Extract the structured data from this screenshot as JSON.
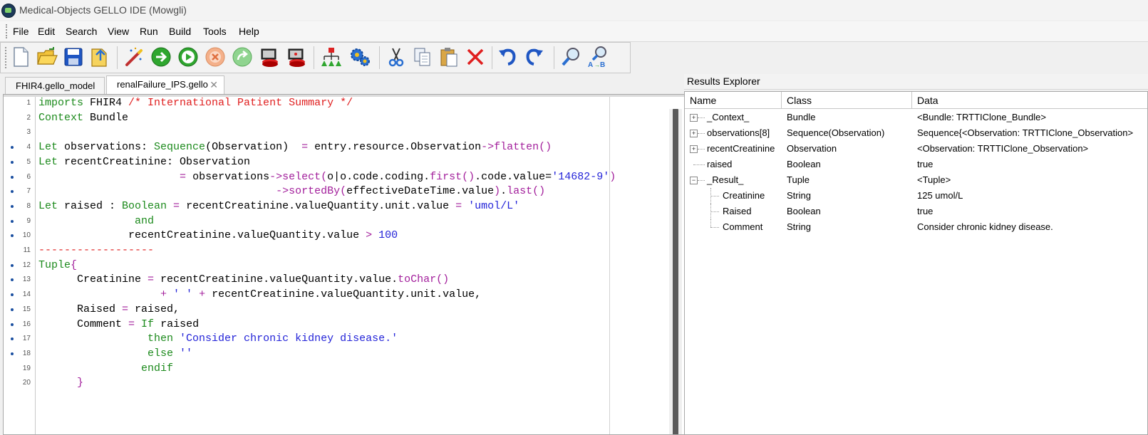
{
  "window": {
    "title": "Medical-Objects GELLO IDE (Mowgli)"
  },
  "menu": [
    "File",
    "Edit",
    "Search",
    "View",
    "Run",
    "Build",
    "Tools",
    "Help"
  ],
  "toolbar": {
    "icons": [
      "new-file-icon",
      "open-folder-icon",
      "save-icon",
      "open-recent-icon",
      "magic-wand-icon",
      "go-arrow-icon",
      "run-icon",
      "stop-icon",
      "step-icon",
      "debug-red-icon",
      "debug-red2-icon",
      "hierarchy-icon",
      "settings-gears-icon",
      "cut-icon",
      "copy-icon",
      "paste-icon",
      "delete-icon",
      "undo-icon",
      "redo-icon",
      "find-icon",
      "replace-icon"
    ]
  },
  "tabs": [
    {
      "label": "FHIR4.gello_model"
    },
    {
      "label": "renalFailure_IPS.gello",
      "close": "✕"
    }
  ],
  "editor": {
    "lines": [
      {
        "n": "1",
        "dot": false,
        "parts": [
          [
            "kw",
            "imports "
          ],
          [
            "id",
            "FHIR4 "
          ],
          [
            "cm",
            "/* International Patient Summary */"
          ]
        ]
      },
      {
        "n": "2",
        "dot": false,
        "parts": [
          [
            "kw",
            "Context "
          ],
          [
            "id",
            "Bundle"
          ]
        ]
      },
      {
        "n": "3",
        "dot": false,
        "parts": []
      },
      {
        "n": "4",
        "dot": true,
        "parts": [
          [
            "kw",
            "Let "
          ],
          [
            "id",
            "observations: "
          ],
          [
            "kw",
            "Sequence"
          ],
          [
            "id",
            "(Observation)  "
          ],
          [
            "op",
            "= "
          ],
          [
            "id",
            "entry.resource.Observation"
          ],
          [
            "op",
            "->flatten()"
          ]
        ]
      },
      {
        "n": "5",
        "dot": true,
        "parts": [
          [
            "kw",
            "Let "
          ],
          [
            "id",
            "recentCreatinine: Observation"
          ]
        ]
      },
      {
        "n": "6",
        "dot": true,
        "parts": [
          [
            "id",
            "                      "
          ],
          [
            "op",
            "= "
          ],
          [
            "id",
            "observations"
          ],
          [
            "op",
            "->select("
          ],
          [
            "id",
            "o|o.code.coding."
          ],
          [
            "op",
            "first()"
          ],
          [
            "id",
            ".code.value="
          ],
          [
            "str",
            "'14682-9'"
          ],
          [
            "op",
            ")"
          ]
        ]
      },
      {
        "n": "7",
        "dot": true,
        "parts": [
          [
            "id",
            "                                     "
          ],
          [
            "op",
            "->sortedBy("
          ],
          [
            "id",
            "effectiveDateTime.value"
          ],
          [
            "op",
            ")"
          ],
          [
            "id",
            "."
          ],
          [
            "op",
            "last()"
          ]
        ]
      },
      {
        "n": "8",
        "dot": true,
        "parts": [
          [
            "kw",
            "Let "
          ],
          [
            "id",
            "raised : "
          ],
          [
            "kw",
            "Boolean "
          ],
          [
            "op",
            "= "
          ],
          [
            "id",
            "recentCreatinine.valueQuantity.unit.value "
          ],
          [
            "op",
            "= "
          ],
          [
            "str",
            "'umol/L'"
          ]
        ]
      },
      {
        "n": "9",
        "dot": true,
        "parts": [
          [
            "id",
            "               "
          ],
          [
            "kw",
            "and"
          ]
        ]
      },
      {
        "n": "10",
        "dot": true,
        "parts": [
          [
            "id",
            "              recentCreatinine.valueQuantity.value "
          ],
          [
            "op",
            "> "
          ],
          [
            "num",
            "100"
          ]
        ]
      },
      {
        "n": "11",
        "dot": false,
        "parts": [
          [
            "dash",
            "------------------"
          ]
        ]
      },
      {
        "n": "12",
        "dot": true,
        "parts": [
          [
            "kw",
            "Tuple"
          ],
          [
            "op",
            "{"
          ]
        ]
      },
      {
        "n": "13",
        "dot": true,
        "parts": [
          [
            "id",
            "      Creatinine "
          ],
          [
            "op",
            "= "
          ],
          [
            "id",
            "recentCreatinine.valueQuantity.value."
          ],
          [
            "op",
            "toChar()"
          ]
        ]
      },
      {
        "n": "14",
        "dot": true,
        "parts": [
          [
            "id",
            "                   "
          ],
          [
            "op",
            "+ "
          ],
          [
            "str",
            "' ' "
          ],
          [
            "op",
            "+ "
          ],
          [
            "id",
            "recentCreatinine.valueQuantity.unit.value,"
          ]
        ]
      },
      {
        "n": "15",
        "dot": true,
        "parts": [
          [
            "id",
            "      Raised "
          ],
          [
            "op",
            "= "
          ],
          [
            "id",
            "raised,"
          ]
        ]
      },
      {
        "n": "16",
        "dot": true,
        "parts": [
          [
            "id",
            "      Comment "
          ],
          [
            "op",
            "= "
          ],
          [
            "kw",
            "If "
          ],
          [
            "id",
            "raised"
          ]
        ]
      },
      {
        "n": "17",
        "dot": true,
        "parts": [
          [
            "id",
            "                 "
          ],
          [
            "kw",
            "then "
          ],
          [
            "str",
            "'Consider chronic kidney disease.'"
          ]
        ]
      },
      {
        "n": "18",
        "dot": true,
        "parts": [
          [
            "id",
            "                 "
          ],
          [
            "kw",
            "else "
          ],
          [
            "str",
            "''"
          ]
        ]
      },
      {
        "n": "19",
        "dot": false,
        "parts": [
          [
            "id",
            "                "
          ],
          [
            "kw",
            "endif"
          ]
        ]
      },
      {
        "n": "20",
        "dot": false,
        "parts": [
          [
            "id",
            "      "
          ],
          [
            "op",
            "}"
          ]
        ]
      }
    ]
  },
  "results": {
    "title": "Results Explorer",
    "columns": [
      "Name",
      "Class",
      "Data"
    ],
    "rows": [
      {
        "name": "_Context_",
        "class": "Bundle",
        "data": "<Bundle: TRTTIClone_Bundle>",
        "expander": "+",
        "level": 0
      },
      {
        "name": "observations[8]",
        "class": "Sequence(Observation)",
        "data": "Sequence{<Observation: TRTTIClone_Observation>",
        "expander": "+",
        "level": 0
      },
      {
        "name": "recentCreatinine",
        "class": "Observation",
        "data": "<Observation: TRTTIClone_Observation>",
        "expander": "+",
        "level": 0
      },
      {
        "name": "raised",
        "class": "Boolean",
        "data": "true",
        "expander": "",
        "level": 0
      },
      {
        "name": "_Result_",
        "class": "Tuple",
        "data": "<Tuple>",
        "expander": "−",
        "level": 0
      },
      {
        "name": "Creatinine",
        "class": "String",
        "data": "125 umol/L",
        "expander": "",
        "level": 1
      },
      {
        "name": "Raised",
        "class": "Boolean",
        "data": "true",
        "expander": "",
        "level": 1
      },
      {
        "name": "Comment",
        "class": "String",
        "data": "Consider chronic kidney disease.",
        "expander": "",
        "level": 1
      }
    ]
  }
}
